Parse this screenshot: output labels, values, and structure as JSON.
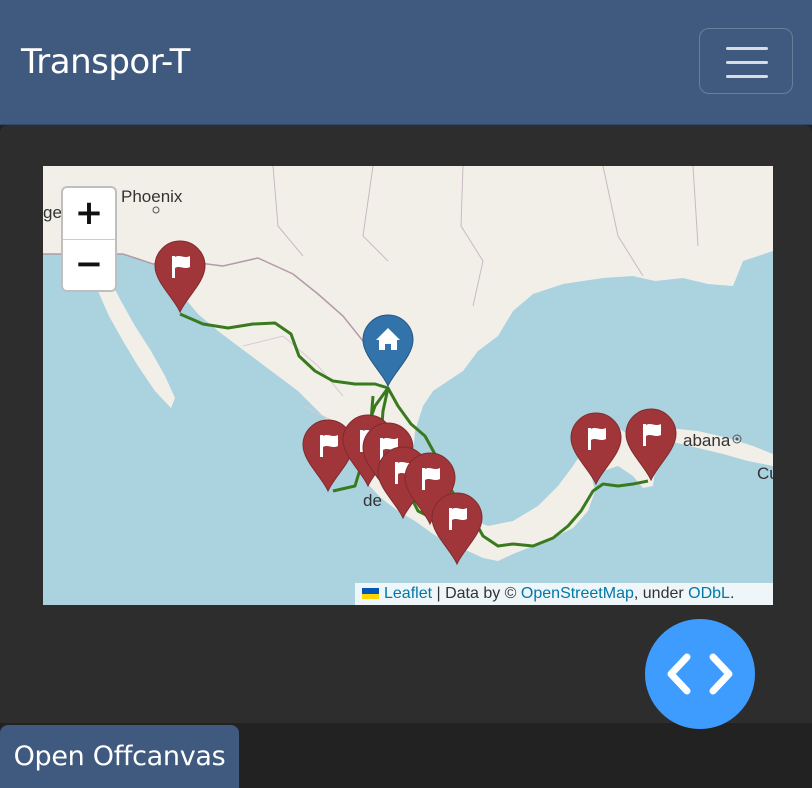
{
  "navbar": {
    "brand": "Transpor-T",
    "toggler_icon": "hamburger-icon"
  },
  "map": {
    "zoom_in_label": "+",
    "zoom_out_label": "−",
    "place_labels": {
      "phoenix": "Phoenix",
      "ge": "ge",
      "habana": "abana",
      "de": "de",
      "cu": "Cu"
    },
    "attribution": {
      "leaflet": "Leaflet",
      "data_by": " | Data by © ",
      "osm": "OpenStreetMap",
      "under": ", under ",
      "odbl": "ODbL",
      "end": "."
    },
    "home_marker_icon": "home-icon",
    "flag_marker_icon": "flag-icon",
    "route_color": "#3a7a1e",
    "marker_color": "#a1363a",
    "home_marker_color": "#3273ab"
  },
  "code_button_icon": "code-icon",
  "offcanvas_button": "Open Offcanvas"
}
